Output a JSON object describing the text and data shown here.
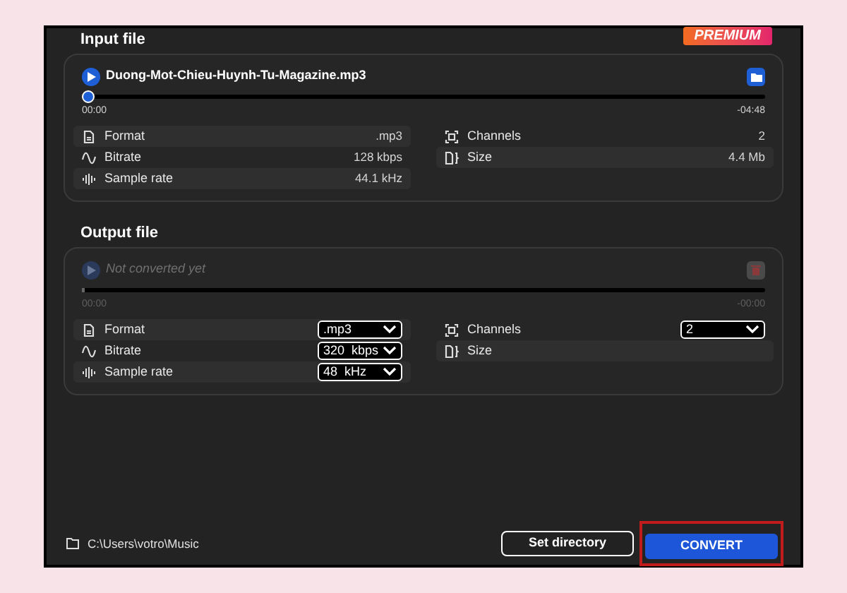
{
  "badge": "PREMIUM",
  "input": {
    "heading": "Input file",
    "file_name": "Duong-Mot-Chieu-Huynh-Tu-Magazine.mp3",
    "disabled": false,
    "level": 0,
    "position": "00:00",
    "remaining": "-04:48",
    "properties": [
      {
        "kind": "text",
        "label": "Format",
        "value": ".mp3"
      },
      {
        "kind": "text",
        "label": "Bitrate",
        "value": "128 kbps"
      },
      {
        "kind": "text",
        "label": "Sample rate",
        "value": "44.1 kHz"
      },
      {
        "kind": "text",
        "label": "Channels",
        "value": "2"
      },
      {
        "kind": "text",
        "label": "Size",
        "value": "4.4 Mb"
      }
    ]
  },
  "output": {
    "heading": "Output file",
    "file_name": "Not converted yet",
    "disabled": true,
    "level": 0,
    "position": "00:00",
    "remaining": "-00:00",
    "properties": [
      {
        "kind": "select",
        "label": "Format",
        "value": ".mp3"
      },
      {
        "kind": "select",
        "label": "Bitrate",
        "value": "320  kbps"
      },
      {
        "kind": "select",
        "label": "Sample rate",
        "value": "48  kHz"
      },
      {
        "kind": "select",
        "label": "Channels",
        "value": "2"
      },
      {
        "kind": "empty",
        "label": "Size"
      }
    ]
  },
  "footer": {
    "path": "C:\\Users\\votro\\Music",
    "set_directory": "Set directory",
    "convert": "CONVERT",
    "convert_highlighted": true
  }
}
